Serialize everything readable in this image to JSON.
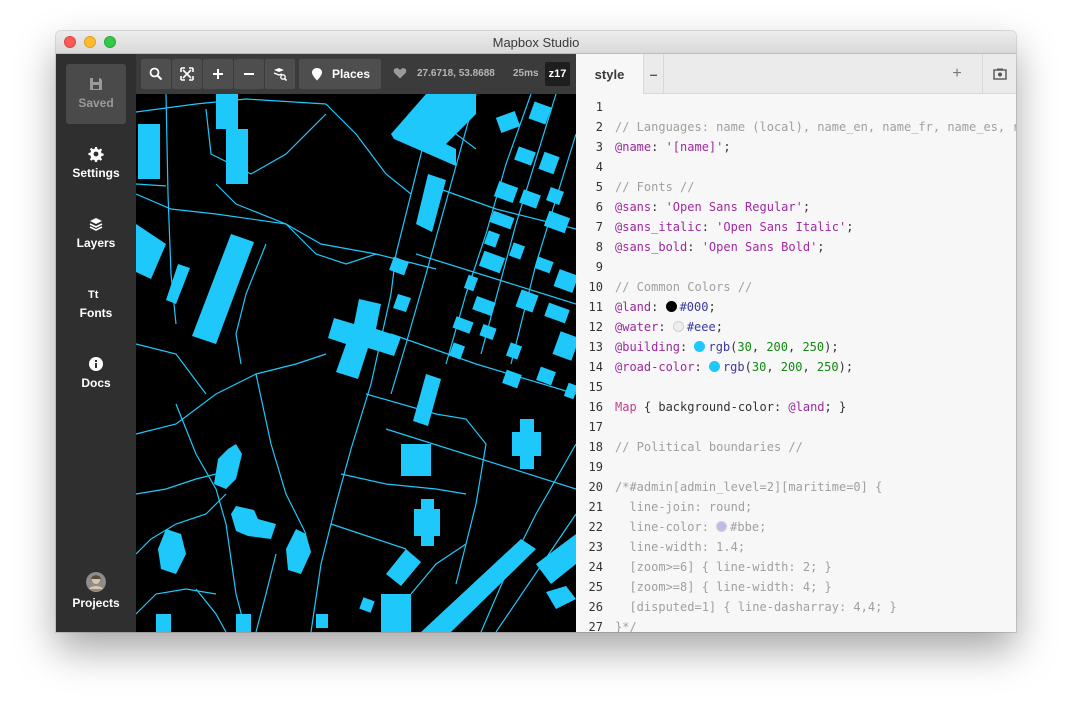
{
  "window": {
    "title": "Mapbox Studio"
  },
  "sidebar": {
    "items": [
      {
        "label": "Saved",
        "icon": "save-icon"
      },
      {
        "label": "Settings",
        "icon": "gear-icon"
      },
      {
        "label": "Layers",
        "icon": "layers-icon"
      },
      {
        "label": "Fonts",
        "icon": "fonts-icon"
      },
      {
        "label": "Docs",
        "icon": "info-icon"
      },
      {
        "label": "Projects",
        "icon": "user-avatar-icon"
      }
    ]
  },
  "toolbar": {
    "places_label": "Places",
    "coords": "27.6718, 53.8688",
    "render_time": "25ms",
    "zoom": "z17"
  },
  "editor": {
    "tab_label": "style",
    "tab_close": "–",
    "add_label": "+",
    "lines": [
      "1",
      "2",
      "3",
      "4",
      "5",
      "6",
      "7",
      "8",
      "9",
      "10",
      "11",
      "12",
      "13",
      "14",
      "15",
      "16",
      "17",
      "18",
      "19",
      "20",
      "21",
      "22",
      "23",
      "24",
      "25",
      "26",
      "27"
    ],
    "code": {
      "l1": "// Languages: name (local), name_en, name_fr, name_es, r",
      "l2_var": "@name",
      "l2_str": "'[name]'",
      "l4": "// Fonts //",
      "l5_var": "@sans",
      "l5_str": "'Open Sans Regular'",
      "l6_var": "@sans_italic",
      "l6_str": "'Open Sans Italic'",
      "l7_var": "@sans_bold",
      "l7_str": "'Open Sans Bold'",
      "l9": "// Common Colors //",
      "l10_var": "@land",
      "l10_val": "#000",
      "l11_var": "@water",
      "l11_val": "#eee",
      "l12_var": "@building",
      "l12_fn": "rgb",
      "l12_args": [
        "30",
        "200",
        "250"
      ],
      "l13_var": "@road-color",
      "l13_fn": "rgb",
      "l13_args": [
        "30",
        "200",
        "250"
      ],
      "l15_sel": "Map",
      "l15_body": " { background-color: ",
      "l15_var": "@land",
      "l15_end": "; }",
      "l17": "// Political boundaries //",
      "l19": "/*#admin[admin_level=2][maritime=0] {",
      "l20": "  line-join: round;",
      "l21_pre": "  line-color: ",
      "l21_val": "#bbe",
      "l21_end": ";",
      "l22": "  line-width: 1.4;",
      "l23": "  [zoom>=6] { line-width: 2; }",
      "l24": "  [zoom>=8] { line-width: 4; }",
      "l25": "  [disputed=1] { line-dasharray: 4,4; }",
      "l26": "}*/"
    }
  },
  "colors": {
    "land": "#000000",
    "water": "#eeeeee",
    "building": "#1ec8fa",
    "road": "#1ec8fa",
    "boundary": "#bbbbee"
  }
}
